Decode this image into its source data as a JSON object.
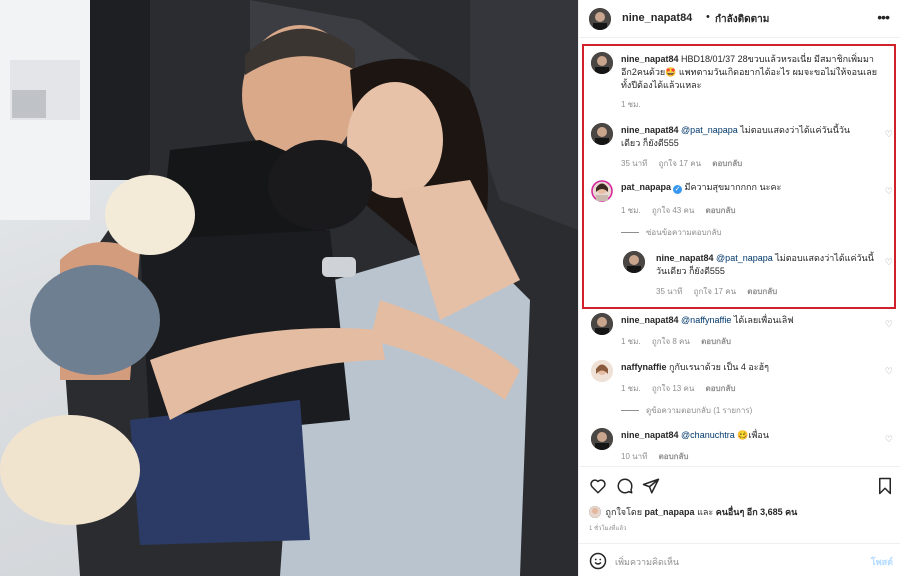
{
  "post": {
    "author": "nine_napat84",
    "dot": "•",
    "follow_state": "กำลังติดตาม",
    "more": "•••"
  },
  "comments": [
    {
      "user": "nine_napat84",
      "text": "HBD18/01/37 28ขวบแล้วหรอเนี่ย มีสมาชิกเพิ่มมาอีก2คนด้วย🤩 แพทตามวันเกิดอยากได้อะไร ผมจะขอไม่ให้จอนเลยทั้งปีต้องได้แล้วแหละ",
      "time": "1 ชม."
    },
    {
      "user": "nine_napat84",
      "mention": "@pat_napapa",
      "text": " ไม่ตอบแสดงว่าได้แค่วันนี้วันเดียว ก็ยังดี555",
      "time": "35 นาที",
      "likes": "ถูกใจ 17 คน",
      "reply": "ตอบกลับ"
    },
    {
      "user": "pat_napapa",
      "verified": "✓",
      "text": "มีความสุขมากกกก นะคะ",
      "time": "1 ชม.",
      "likes": "ถูกใจ 43 คน",
      "reply": "ตอบกลับ",
      "toggle": "ซ่อนข้อความตอบกลับ",
      "replies": [
        {
          "user": "nine_napat84",
          "mention": "@pat_napapa",
          "text": " ไม่ตอบแสดงว่าได้แค่วันนี้วันเดียว ก็ยังดี555",
          "time": "35 นาที",
          "likes": "ถูกใจ 17 คน",
          "reply": "ตอบกลับ"
        }
      ]
    },
    {
      "user": "nine_napat84",
      "mention": "@naffynaffie",
      "text": " ได้เลยเพื่อนเลิฟ",
      "time": "1 ชม.",
      "likes": "ถูกใจ 8 คน",
      "reply": "ตอบกลับ"
    },
    {
      "user": "naffynaffie",
      "text": "กูกับเรนาด้วย เป็น 4 อะฮ้ๆ",
      "time": "1 ชม.",
      "likes": "ถูกใจ 13 คน",
      "reply": "ตอบกลับ",
      "toggle": "ดูข้อความตอบกลับ (1 รายการ)"
    },
    {
      "user": "nine_napat84",
      "mention": "@chanuchtra",
      "text": " 🥴เพื่อน",
      "time": "10 นาที",
      "reply": "ตอบกลับ"
    }
  ],
  "likes_line": {
    "prefix": "ถูกใจโดย ",
    "user": "pat_napapa",
    "mid": " และ ",
    "others": "คนอื่นๆ อีก 3,685 คน"
  },
  "post_time": "1 ชั่วโมงที่แล้ว",
  "add_comment": {
    "placeholder": "เพิ่มความคิดเห็น",
    "post_label": "โพสต์"
  },
  "icons": [
    "heart-icon",
    "comment-icon",
    "share-icon",
    "bookmark-icon",
    "emoji-icon",
    "more-icon",
    "verified-icon"
  ],
  "colors": {
    "highlight": "#d0212b",
    "mention": "#00376b",
    "muted": "#8e8e8e",
    "verified": "#3897f0",
    "post_disabled": "#b3dbff"
  }
}
